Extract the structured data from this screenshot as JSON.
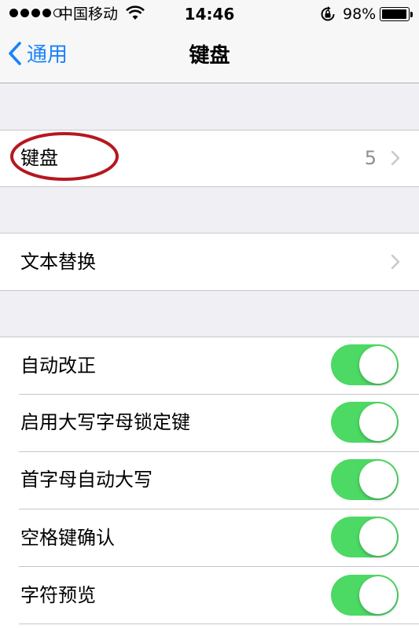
{
  "status_bar": {
    "carrier": "中国移动",
    "time": "14:46",
    "battery_percent": "98%",
    "battery_level": 0.98,
    "signal_bars_filled": 4,
    "signal_bars_total": 5,
    "icons": [
      "signal-dots-icon",
      "wifi-icon",
      "rotation-lock-icon",
      "battery-icon"
    ]
  },
  "nav": {
    "back_label": "通用",
    "title": "键盘",
    "accent_color": "#1a82fb"
  },
  "rows": {
    "keyboards": {
      "label": "键盘",
      "detail": "5"
    },
    "text_replacement": {
      "label": "文本替换"
    }
  },
  "toggles": [
    {
      "label": "自动改正",
      "on": true
    },
    {
      "label": "启用大写字母锁定键",
      "on": true
    },
    {
      "label": "首字母自动大写",
      "on": true
    },
    {
      "label": "空格键确认",
      "on": true
    },
    {
      "label": "字符预览",
      "on": true
    }
  ],
  "colors": {
    "toggle_on": "#4cd964",
    "annotation_circle": "#b5181f",
    "background": "#efeff4"
  }
}
